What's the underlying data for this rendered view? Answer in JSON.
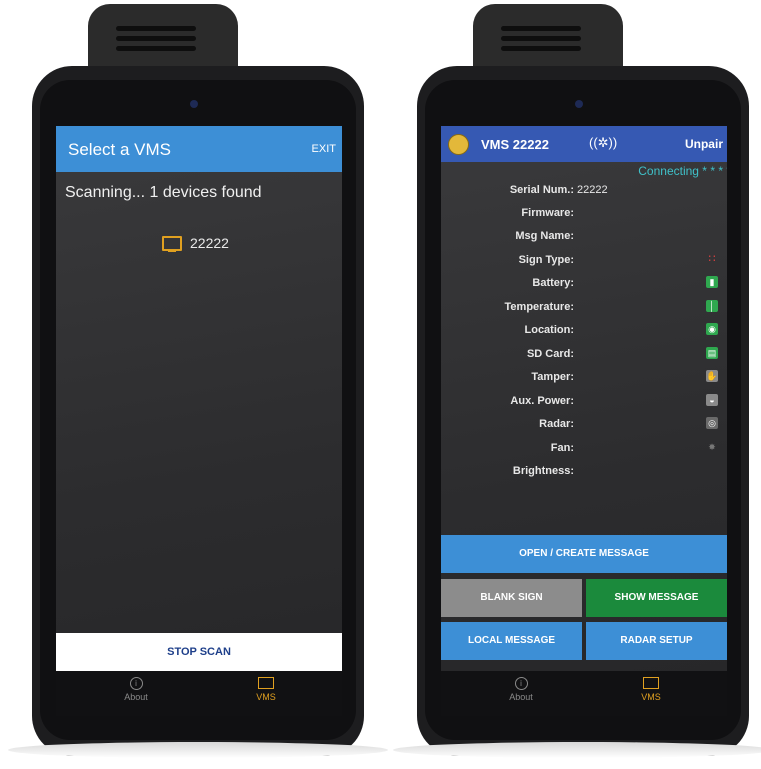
{
  "left_phone": {
    "appbar": {
      "title": "Select a VMS",
      "exit_label": "EXIT"
    },
    "status_text": "Scanning... 1 devices found",
    "devices": [
      {
        "id": "22222",
        "icon": "monitor-icon"
      }
    ],
    "stop_scan_label": "STOP SCAN",
    "nav": {
      "about_label": "About",
      "vms_label": "VMS"
    }
  },
  "right_phone": {
    "header": {
      "vms_name": "VMS 22222",
      "bluetooth_icon": "bluetooth-icon",
      "unpair_label": "Unpair"
    },
    "connection_status": "Connecting * * * *",
    "fields": [
      {
        "label": "Serial Num.:",
        "value": "22222"
      },
      {
        "label": "Firmware:",
        "value": ""
      },
      {
        "label": "Msg Name:",
        "value": ""
      },
      {
        "label": "Sign Type:",
        "value": "",
        "icon": "sign-type-icon"
      },
      {
        "label": "Battery:",
        "value": "",
        "icon": "battery-icon"
      },
      {
        "label": "Temperature:",
        "value": "",
        "icon": "thermometer-icon"
      },
      {
        "label": "Location:",
        "value": "",
        "icon": "location-pin-icon"
      },
      {
        "label": "SD Card:",
        "value": "",
        "icon": "sd-card-icon"
      },
      {
        "label": "Tamper:",
        "value": "",
        "icon": "tamper-icon"
      },
      {
        "label": "Aux. Power:",
        "value": "",
        "icon": "aux-power-icon"
      },
      {
        "label": "Radar:",
        "value": "",
        "icon": "radar-icon"
      },
      {
        "label": "Fan:",
        "value": "",
        "icon": "fan-icon"
      },
      {
        "label": "Brightness:",
        "value": ""
      }
    ],
    "buttons": {
      "open_create": "OPEN / CREATE MESSAGE",
      "blank_sign": "BLANK SIGN",
      "show_message": "SHOW MESSAGE",
      "local_message": "LOCAL MESSAGE",
      "radar_setup": "RADAR SETUP"
    },
    "nav": {
      "about_label": "About",
      "vms_label": "VMS"
    }
  },
  "colors": {
    "primary_blue": "#3d8fd6",
    "header_blue": "#3659b3",
    "accent_orange": "#e0a020",
    "show_green": "#1b8a3c",
    "blank_gray": "#8c8c8c",
    "status_teal": "#3fc1c9"
  }
}
